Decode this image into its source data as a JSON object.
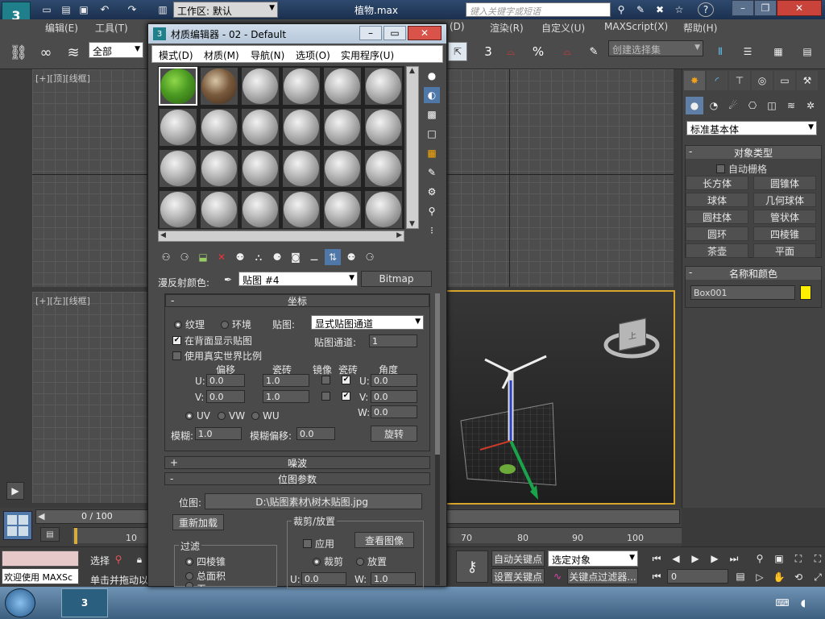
{
  "app": {
    "doc_title": "植物.max",
    "workspace_label": "工作区: 默认",
    "search_placeholder": "键入关键字或短语"
  },
  "menu": [
    "编辑(E)",
    "工具(T)",
    "(D)",
    "渲染(R)",
    "自定义(U)",
    "MAXScript(X)",
    "帮助(H)"
  ],
  "toolbar": {
    "filter_all": "全部",
    "selection_set_placeholder": "创建选择集"
  },
  "viewports": {
    "top_label": "[+][顶][线框]",
    "left_label": "[+][左][线框]",
    "persp_cube_label": "上"
  },
  "command_panel": {
    "category": "标准基本体",
    "object_type_title": "对象类型",
    "autogrid": "自动栅格",
    "buttons": [
      "长方体",
      "圆锥体",
      "球体",
      "几何球体",
      "圆柱体",
      "管状体",
      "圆环",
      "四棱锥",
      "茶壶",
      "平面"
    ],
    "name_color_title": "名称和颜色",
    "object_name": "Box001",
    "object_color": "#ffee00"
  },
  "timeline": {
    "frame_counter": "0 / 100",
    "ticks": [
      "10",
      "70",
      "80",
      "90",
      "100"
    ]
  },
  "status": {
    "welcome": "欢迎使用 MAXSc",
    "select_label": "选择",
    "prompt": "单击并拖动以",
    "auto_key": "自动关键点",
    "set_key": "设置关键点",
    "selected_object": "选定对象",
    "key_filters": "关键点过滤器...",
    "current_frame": "0"
  },
  "material_editor": {
    "title": "材质编辑器 - 02 - Default",
    "menu": [
      "模式(D)",
      "材质(M)",
      "导航(N)",
      "选项(O)",
      "实用程序(U)"
    ],
    "diffuse_label": "漫反射颜色:",
    "map_name": "贴图 #4",
    "map_type": "Bitmap",
    "coords": {
      "title": "坐标",
      "texture": "纹理",
      "environ": "环境",
      "mapping_label": "贴图:",
      "mapping_value": "显式贴图通道",
      "show_back": "在背面显示贴图",
      "channel_label": "贴图通道:",
      "channel_value": "1",
      "real_world": "使用真实世界比例",
      "offset": "偏移",
      "tiling": "瓷砖",
      "mirror": "镜像",
      "tile": "瓷砖",
      "angle": "角度",
      "u": "U:",
      "v": "V:",
      "w": "W:",
      "u_offset": "0.0",
      "v_offset": "0.0",
      "u_tiling": "1.0",
      "v_tiling": "1.0",
      "u_angle": "0.0",
      "v_angle": "0.0",
      "w_angle": "0.0",
      "uv": "UV",
      "vw": "VW",
      "wu": "WU",
      "blur_label": "模糊:",
      "blur": "1.0",
      "blur_offset_label": "模糊偏移:",
      "blur_offset": "0.0",
      "rotate": "旋转"
    },
    "noise_title": "噪波",
    "bitmap_params": {
      "title": "位图参数",
      "bitmap_label": "位图:",
      "bitmap_path": "D:\\贴图素材\\树木贴图.jpg",
      "reload": "重新加载",
      "crop_title": "裁剪/放置",
      "apply": "应用",
      "view_image": "查看图像",
      "crop": "裁剪",
      "place": "放置",
      "u": "U:",
      "u_value": "0.0",
      "w": "W:",
      "w_value": "1.0",
      "filter_title": "过滤",
      "pyramidal": "四棱锥",
      "summed_area": "总面积",
      "none": "无"
    }
  }
}
